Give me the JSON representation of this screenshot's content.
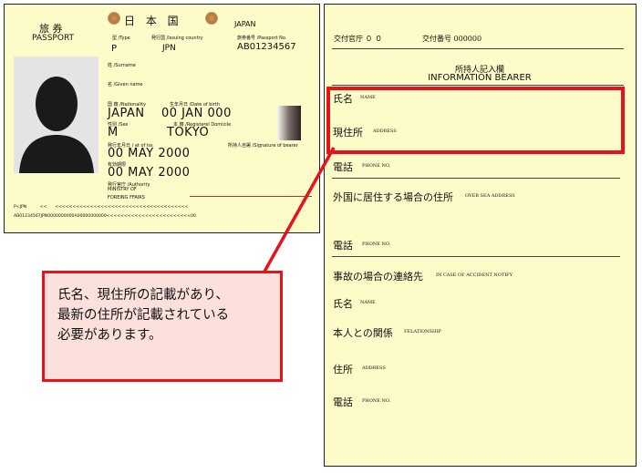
{
  "passport": {
    "title_jp": "旅 券",
    "title_en": "PASSPORT",
    "country_jp": "日 本 国",
    "country_en": "JAPAN",
    "type_label": "型 /Type",
    "issuing_country_label": "発行国 /Issuing country",
    "passport_no_label": "旅券番号 /Passport No.",
    "type_value": "P",
    "issuing_country_value": "JPN",
    "passport_no_value": "AB01234567",
    "surname_label": "姓 /Surname",
    "given_name_label": "名 /Given name",
    "nationality_label": "国 籍 /Nationality",
    "dob_label": "生年月日 /Date of birth",
    "nationality_value": "JAPAN",
    "dob_value": "00 JAN 000",
    "sex_label": "性別 /Sex",
    "domicile_label": "本 籍 /Registerel Domicile",
    "sex_value": "M",
    "domicile_value": "TOKYO",
    "issue_date_label": "発行年月日 / at of Iss",
    "signature_label": "所持人自署 /Signature of bearer",
    "issue_date_value": "00 MAY 2000",
    "expiry_label": "有効期限",
    "expiry_value": "00 MAY 2000",
    "authority_label": "発行官庁 /Authority",
    "authority_value_1": "MINISTRY OF",
    "authority_value_2": "FOREING FFAIRS",
    "mrz_1": "P<JPN          <<      <<<<<<<<<<<<<<<<<<<<<<<<<<<<<<<<<<<<<<",
    "mrz_2": "AB01234567JPN0000000000A00000000000<<<<<<<<<<<<<<<<<<<<<<<<00"
  },
  "bearer_page": {
    "issuing_office": "交付官庁 ０ ０",
    "issue_number": "交付番号 000000",
    "header_jp": "所持人記入欄",
    "header_en": "INFORMATION BEARER",
    "name_jp": "氏名",
    "name_en": "NAME",
    "address_jp": "現住所",
    "address_en": "ADDRESS",
    "phone_jp": "電話",
    "phone_en": "PHONE NO.",
    "overseas_jp": "外国に居住する場合の住所",
    "overseas_en": "OVER SEA ADDRESS",
    "phone2_jp": "電話",
    "phone2_en": "PHONE NO.",
    "emergency_jp": "事故の場合の連絡先",
    "emergency_en": "IN CASE OF ACCIDENT NOTIFY",
    "name2_jp": "氏名",
    "name2_en": "NAME",
    "relation_jp": "本人との関係",
    "relation_en": "FELATIONSHIP",
    "address2_jp": "住所",
    "address2_en": "ADDRESS",
    "phone3_jp": "電話",
    "phone3_en": "PHONE NO."
  },
  "callout": {
    "line1": "氏名、現住所の記載があり、",
    "line2": "最新の住所が記載されている",
    "line3": "必要があります。"
  },
  "colors": {
    "paper": "#fdfbc8",
    "highlight": "#e8121b",
    "callout_bg": "#fbe0dc"
  }
}
